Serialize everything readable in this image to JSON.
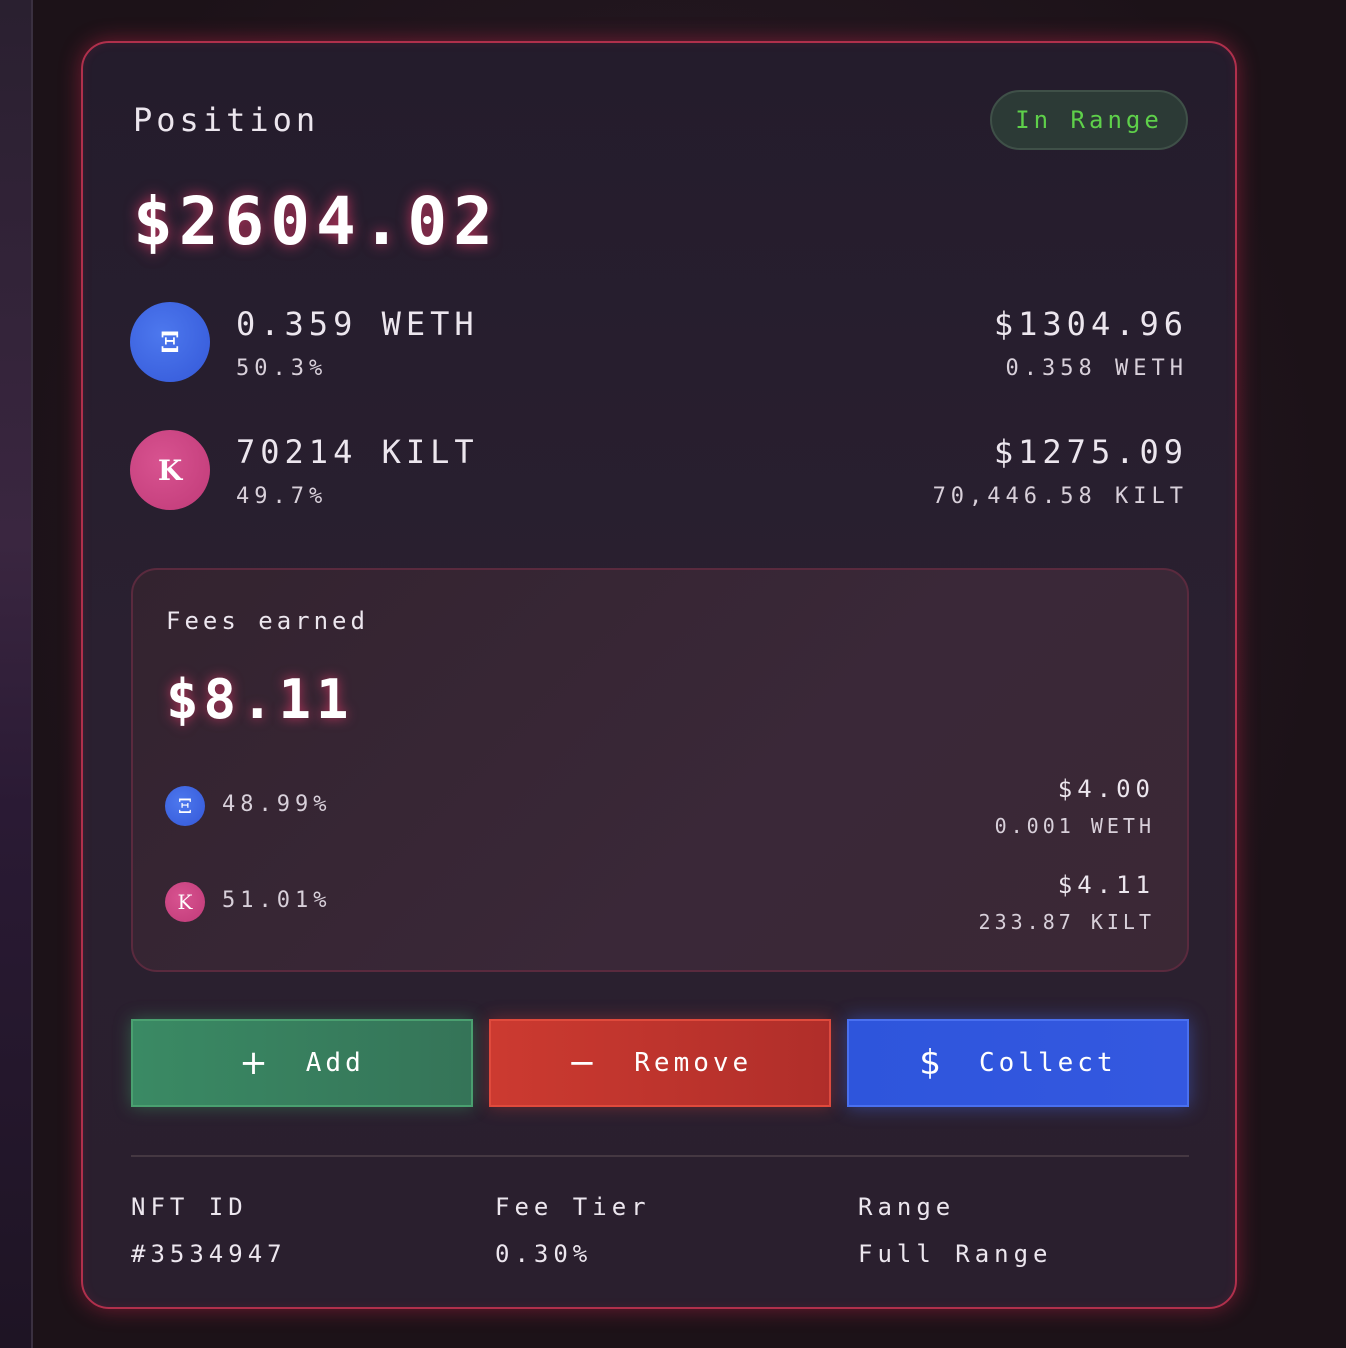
{
  "position": {
    "title": "Position",
    "status_badge": "In Range",
    "total_value": "$2604.02"
  },
  "tokens": [
    {
      "icon": "Ξ",
      "icon_name": "eth-icon",
      "amount": "0.359 WETH",
      "share": "50.3%",
      "usd_value": "$1304.96",
      "sub_amount": "0.358 WETH",
      "color": "#3a5de0"
    },
    {
      "icon": "K",
      "icon_name": "kilt-icon",
      "amount": "70214 KILT",
      "share": "49.7%",
      "usd_value": "$1275.09",
      "sub_amount": "70,446.58 KILT",
      "color": "#c8427f"
    }
  ],
  "fees": {
    "label": "Fees earned",
    "total": "$8.11",
    "items": [
      {
        "icon": "Ξ",
        "share": "48.99%",
        "usd_value": "$4.00",
        "sub_amount": "0.001 WETH"
      },
      {
        "icon": "K",
        "share": "51.01%",
        "usd_value": "$4.11",
        "sub_amount": "233.87 KILT"
      }
    ]
  },
  "actions": {
    "add": {
      "icon": "+",
      "label": "Add"
    },
    "remove": {
      "icon": "−",
      "label": "Remove"
    },
    "collect": {
      "icon": "$",
      "label": "Collect"
    }
  },
  "details": [
    {
      "label": "NFT ID",
      "value": "#3534947"
    },
    {
      "label": "Fee Tier",
      "value": "0.30%"
    },
    {
      "label": "Range",
      "value": "Full Range"
    }
  ],
  "colors": {
    "accent_border": "#b0304c",
    "in_range_text": "#5ed04a",
    "add_button": "#3a8a64",
    "remove_button": "#cc3a30",
    "collect_button": "#3458e0"
  }
}
